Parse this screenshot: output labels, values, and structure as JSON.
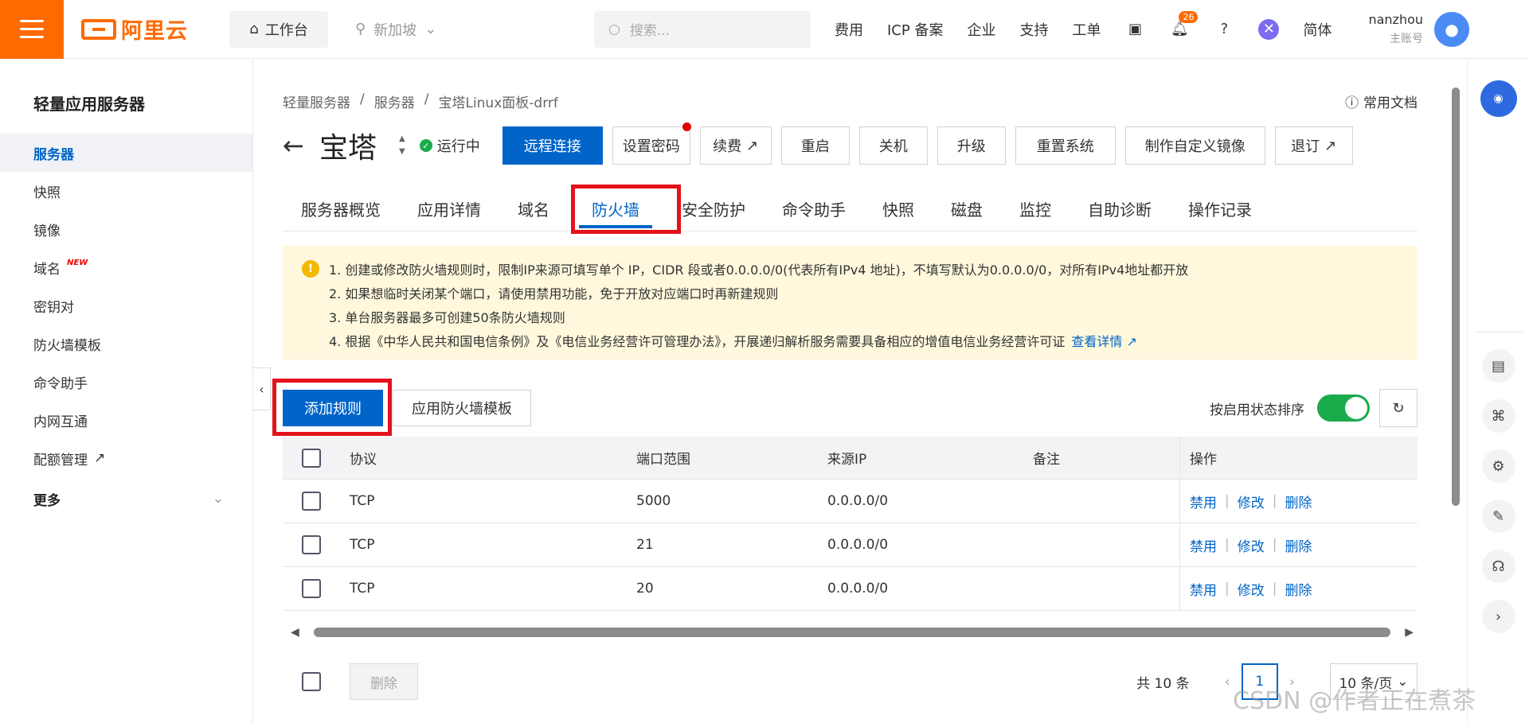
{
  "topbar": {
    "logo_text": "阿里云",
    "workbench_label": "工作台",
    "region_label": "新加坡",
    "search_placeholder": "搜索...",
    "links": [
      "费用",
      "ICP 备案",
      "企业",
      "支持",
      "工单"
    ],
    "notification_count": "26",
    "language_label": "简体",
    "user_name": "nanzhou",
    "user_role": "主账号"
  },
  "sidebar": {
    "title": "轻量应用服务器",
    "items": [
      {
        "label": "服务器",
        "active": true
      },
      {
        "label": "快照"
      },
      {
        "label": "镜像"
      },
      {
        "label": "域名",
        "tag": "NEW"
      },
      {
        "label": "密钥对"
      },
      {
        "label": "防火墙模板"
      },
      {
        "label": "命令助手"
      },
      {
        "label": "内网互通"
      },
      {
        "label": "配额管理"
      }
    ],
    "more_label": "更多"
  },
  "main": {
    "breadcrumb": [
      "轻量服务器",
      "/",
      "服务器",
      "/",
      "宝塔Linux面板-drrf"
    ],
    "doc_link": "常用文档",
    "title": "宝塔",
    "status": "运行中",
    "actions": [
      {
        "label": "远程连接",
        "primary": true
      },
      {
        "label": "设置密码",
        "dot": true
      },
      {
        "label": "续费",
        "external": true
      },
      {
        "label": "重启"
      },
      {
        "label": "关机"
      },
      {
        "label": "升级"
      },
      {
        "label": "重置系统"
      },
      {
        "label": "制作自定义镜像"
      },
      {
        "label": "退订",
        "external": true
      }
    ],
    "tabs": [
      "服务器概览",
      "应用详情",
      "域名",
      "防火墙",
      "安全防护",
      "命令助手",
      "快照",
      "磁盘",
      "监控",
      "自助诊断",
      "操作记录"
    ],
    "active_tab": "防火墙",
    "notice": [
      "1. 创建或修改防火墙规则时，限制IP来源可填写单个 IP，CIDR 段或者0.0.0.0/0(代表所有IPv4 地址)，不填写默认为0.0.0.0/0，对所有IPv4地址都开放",
      "2. 如果想临时关闭某个端口，请使用禁用功能，免于开放对应端口时再新建规则",
      "3. 单台服务器最多可创建50条防火墙规则",
      "4. 根据《中华人民共和国电信条例》及《电信业务经营许可管理办法》，开展递归解析服务需要具备相应的增值电信业务经营许可证"
    ],
    "notice_link": "查看详情",
    "add_rule_label": "添加规则",
    "apply_template_label": "应用防火墙模板",
    "sort_label": "按启用状态排序",
    "sort_enabled": true,
    "table": {
      "headers": [
        "协议",
        "端口范围",
        "来源IP",
        "备注",
        "操作"
      ],
      "rows": [
        {
          "protocol": "TCP",
          "port": "5000",
          "source": "0.0.0.0/0",
          "note": ""
        },
        {
          "protocol": "TCP",
          "port": "21",
          "source": "0.0.0.0/0",
          "note": ""
        },
        {
          "protocol": "TCP",
          "port": "20",
          "source": "0.0.0.0/0",
          "note": ""
        }
      ],
      "ops": [
        "禁用",
        "修改",
        "删除"
      ]
    },
    "delete_label": "删除",
    "total_label": "共 10 条",
    "current_page": "1",
    "page_size_label": "10 条/页"
  },
  "watermark": "CSDN @作者正在煮茶"
}
